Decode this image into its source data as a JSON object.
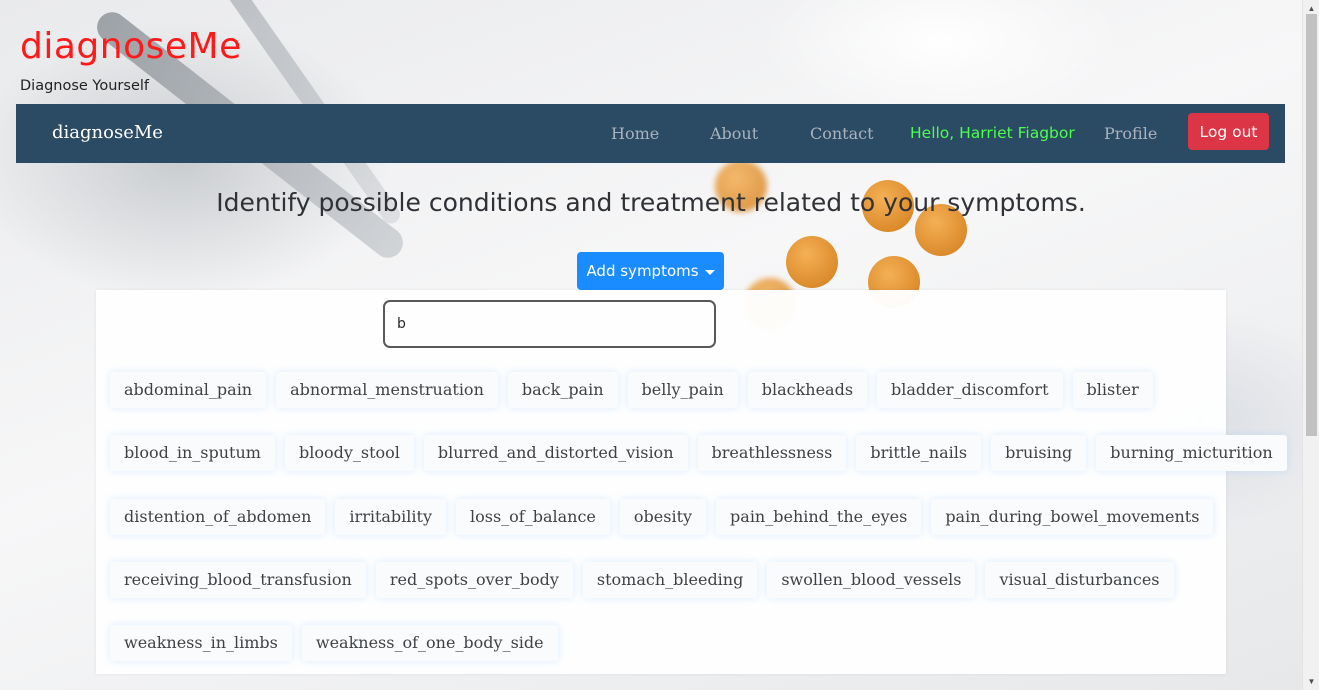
{
  "header": {
    "brand": "diagnoseMe",
    "tagline": "Diagnose Yourself"
  },
  "navbar": {
    "brand": "diagnoseMe",
    "links": [
      "Home",
      "About",
      "Contact"
    ],
    "greeting": "Hello, Harriet Fiagbor",
    "profile": "Profile",
    "logout": "Log out"
  },
  "main": {
    "headline": "Identify possible conditions and treatment related to your symptoms.",
    "add_symptoms_label": "Add symptoms",
    "search_value": "b"
  },
  "symptoms": [
    [
      "abdominal_pain",
      "abnormal_menstruation",
      "back_pain",
      "belly_pain",
      "blackheads",
      "bladder_discomfort",
      "blister"
    ],
    [
      "blood_in_sputum",
      "bloody_stool",
      "blurred_and_distorted_vision",
      "breathlessness",
      "brittle_nails",
      "bruising",
      "burning_micturition"
    ],
    [
      "distention_of_abdomen",
      "irritability",
      "loss_of_balance",
      "obesity",
      "pain_behind_the_eyes",
      "pain_during_bowel_movements"
    ],
    [
      "receiving_blood_transfusion",
      "red_spots_over_body",
      "stomach_bleeding",
      "swollen_blood_vessels",
      "visual_disturbances"
    ],
    [
      "weakness_in_limbs",
      "weakness_of_one_body_side"
    ]
  ],
  "colors": {
    "brand": "#ff1a1a",
    "navbar": "#2b4a64",
    "greeting": "#4dff4d",
    "logout": "#dc3545",
    "primary": "#1a8cff"
  },
  "icons": {
    "dropdown": "caret-down-icon",
    "scroll_up": "scroll-up-arrow-icon",
    "scroll_down": "scroll-down-arrow-icon"
  }
}
